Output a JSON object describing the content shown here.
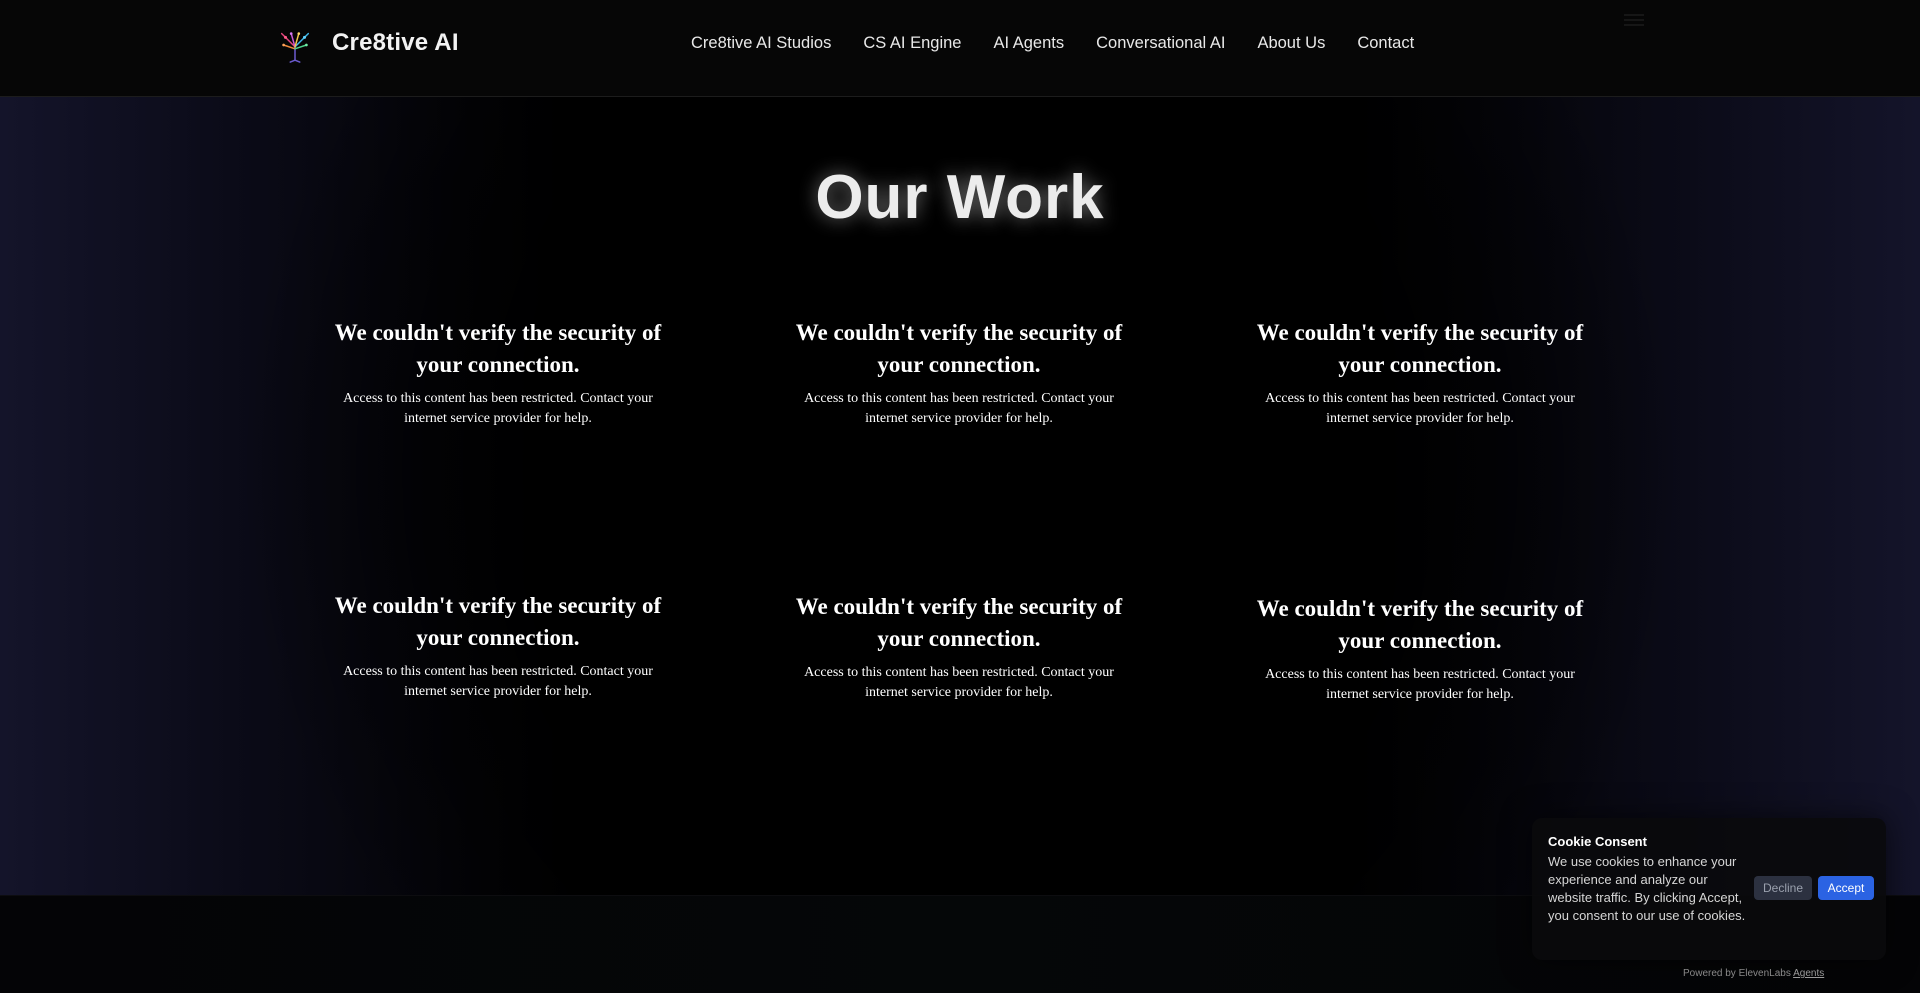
{
  "header": {
    "brand": "Cre8tive AI",
    "nav": [
      {
        "label": "Cre8tive AI Studios"
      },
      {
        "label": "CS AI Engine"
      },
      {
        "label": "AI Agents"
      },
      {
        "label": "Conversational AI"
      },
      {
        "label": "About Us"
      },
      {
        "label": "Contact"
      }
    ]
  },
  "main": {
    "title": "Our Work",
    "cards": [
      {
        "heading": "We couldn't verify the security of your connection.",
        "body": "Access to this content has been restricted. Contact your internet service provider for help."
      },
      {
        "heading": "We couldn't verify the security of your connection.",
        "body": "Access to this content has been restricted. Contact your internet service provider for help."
      },
      {
        "heading": "We couldn't verify the security of your connection.",
        "body": "Access to this content has been restricted. Contact your internet service provider for help."
      },
      {
        "heading": "We couldn't verify the security of your connection.",
        "body": "Access to this content has been restricted. Contact your internet service provider for help."
      },
      {
        "heading": "We couldn't verify the security of your connection.",
        "body": "Access to this content has been restricted. Contact your internet service provider for help."
      },
      {
        "heading": "We couldn't verify the security of your connection.",
        "body": "Access to this content has been restricted. Contact your internet service provider for help."
      }
    ]
  },
  "cookie": {
    "title": "Cookie Consent",
    "text": "We use cookies to enhance your experience and analyze our website traffic. By clicking Accept, you consent to our use of cookies.",
    "decline_label": "Decline",
    "accept_label": "Accept"
  },
  "widget": {
    "powered_prefix": "Powered by ElevenLabs",
    "powered_link": "Agents"
  },
  "colors": {
    "accept": "#2b63e3",
    "decline": "#2c3140",
    "background": "#000000"
  },
  "icons": {
    "logo": "tree-logo-icon",
    "menu": "hamburger-menu-icon"
  }
}
